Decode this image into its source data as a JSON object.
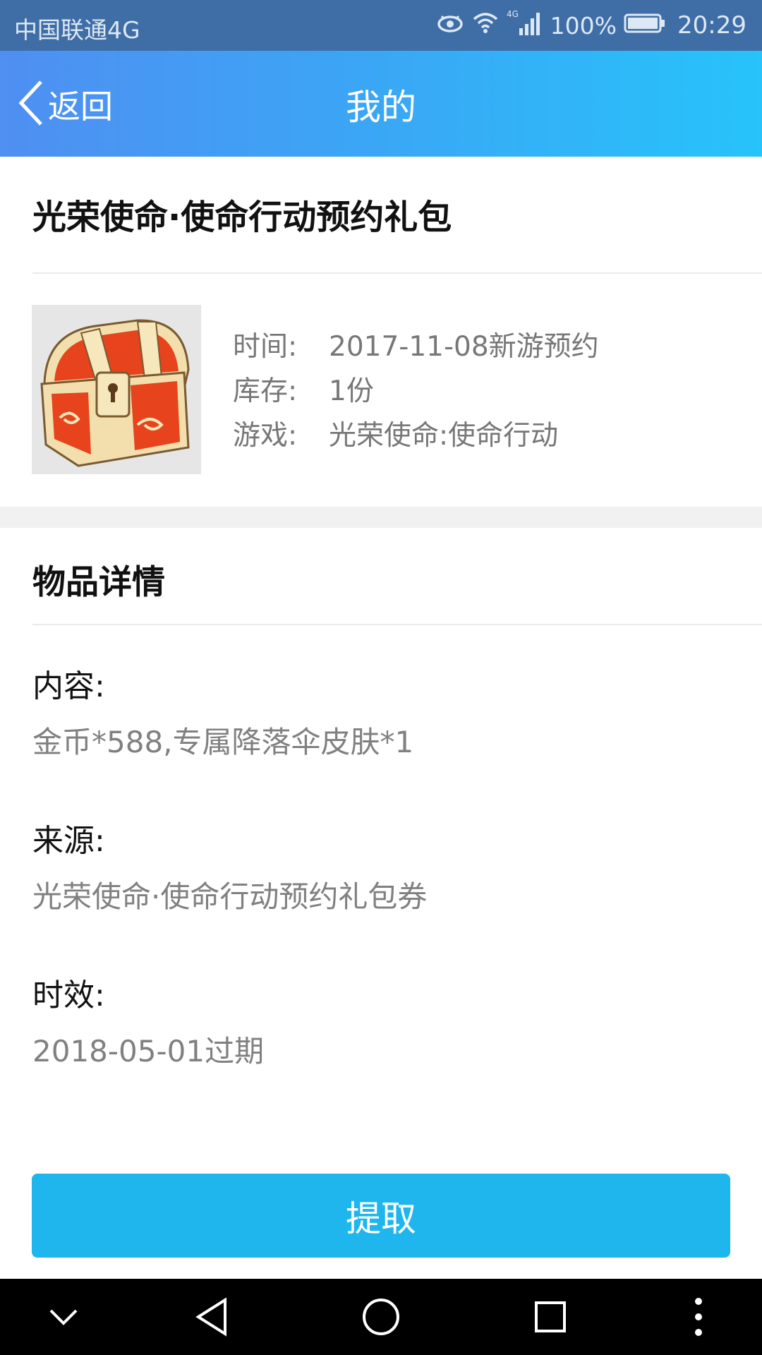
{
  "status_bar": {
    "carrier": "中国联通4G",
    "battery_percent": "100%",
    "time": "20:29",
    "icons": [
      "eye-icon",
      "wifi-icon",
      "signal-4g-icon",
      "battery-icon"
    ]
  },
  "nav": {
    "back_label": "返回",
    "title": "我的"
  },
  "gift": {
    "title": "光荣使命·使命行动预约礼包",
    "image_icon": "treasure-chest-icon",
    "info": [
      {
        "key": "时间:",
        "value": "2017-11-08新游预约"
      },
      {
        "key": "库存:",
        "value": "1份"
      },
      {
        "key": "游戏:",
        "value": "光荣使命:使命行动"
      }
    ]
  },
  "details": {
    "title": "物品详情",
    "content_label": "内容:",
    "content_value": "金币*588,专属降落伞皮肤*1",
    "source_label": "来源:",
    "source_value": "光荣使命·使命行动预约礼包券",
    "validity_label": "时效:",
    "validity_value": "2018-05-01过期"
  },
  "claim_button": "提取",
  "system_nav": [
    "chevron-down-icon",
    "back-triangle-icon",
    "home-circle-icon",
    "recents-square-icon",
    "more-vert-icon"
  ],
  "colors": {
    "status_bar": "#3f6ea6",
    "nav_gradient_start": "#4f8ff2",
    "nav_gradient_end": "#27c3fb",
    "button": "#1eb6ed"
  }
}
